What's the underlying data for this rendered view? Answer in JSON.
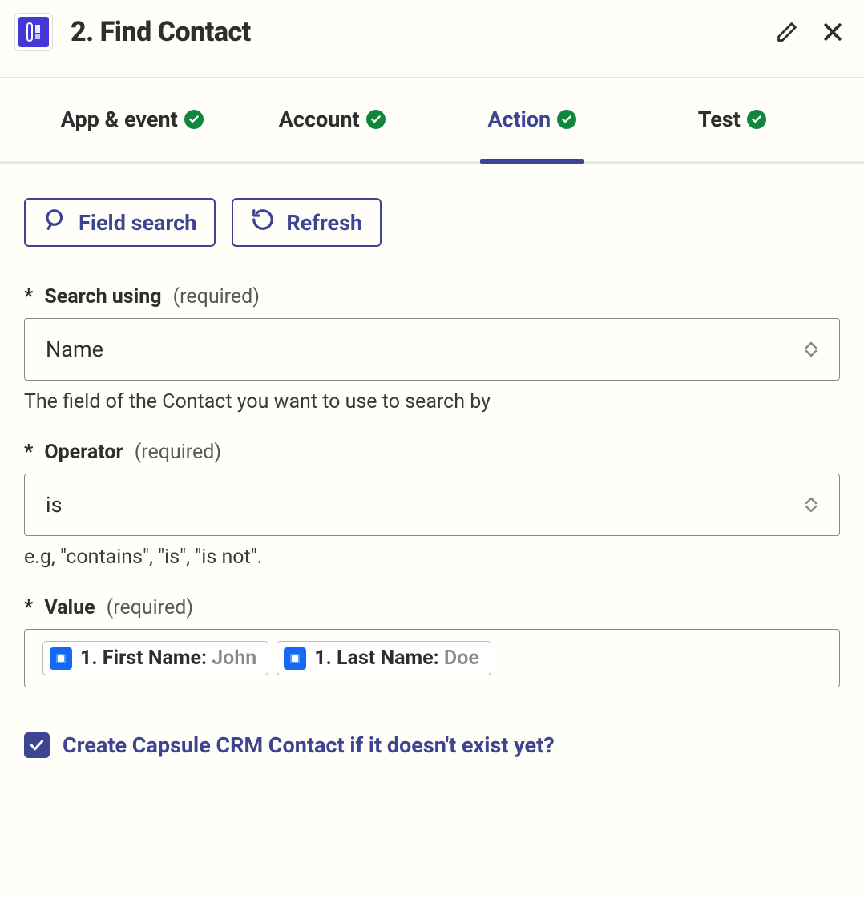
{
  "header": {
    "title": "2. Find Contact"
  },
  "tabs": [
    {
      "label": "App & event",
      "active": false,
      "complete": true
    },
    {
      "label": "Account",
      "active": false,
      "complete": true
    },
    {
      "label": "Action",
      "active": true,
      "complete": true
    },
    {
      "label": "Test",
      "active": false,
      "complete": true
    }
  ],
  "toolbar": {
    "field_search_label": "Field search",
    "refresh_label": "Refresh"
  },
  "fields": {
    "search_using": {
      "asterisk": "*",
      "label": "Search using",
      "required_text": "(required)",
      "value": "Name",
      "help": "The field of the Contact you want to use to search by"
    },
    "operator": {
      "asterisk": "*",
      "label": "Operator",
      "required_text": "(required)",
      "value": "is",
      "help": "e.g, \"contains\", \"is\", \"is not\"."
    },
    "value": {
      "asterisk": "*",
      "label": "Value",
      "required_text": "(required)",
      "pills": [
        {
          "label": "1. First Name: ",
          "value": "John"
        },
        {
          "label": "1. Last Name: ",
          "value": "Doe"
        }
      ]
    }
  },
  "create_checkbox": {
    "checked": true,
    "label": "Create Capsule CRM Contact if it doesn't exist yet?"
  }
}
